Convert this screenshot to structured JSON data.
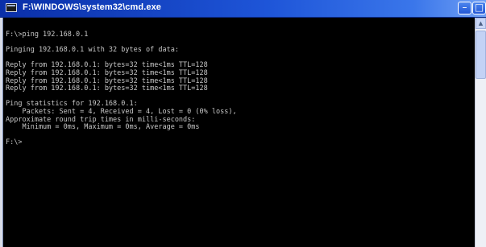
{
  "window": {
    "title": "F:\\WINDOWS\\system32\\cmd.exe",
    "icon": "console-icon",
    "controls": {
      "minimize": "–",
      "maximize": "□"
    }
  },
  "console": {
    "lines": [
      "F:\\>ping 192.168.0.1",
      "",
      "Pinging 192.168.0.1 with 32 bytes of data:",
      "",
      "Reply from 192.168.0.1: bytes=32 time<1ms TTL=128",
      "Reply from 192.168.0.1: bytes=32 time<1ms TTL=128",
      "Reply from 192.168.0.1: bytes=32 time<1ms TTL=128",
      "Reply from 192.168.0.1: bytes=32 time<1ms TTL=128",
      "",
      "Ping statistics for 192.168.0.1:",
      "    Packets: Sent = 4, Received = 4, Lost = 0 (0% loss),",
      "Approximate round trip times in milli-seconds:",
      "    Minimum = 0ms, Maximum = 0ms, Average = 0ms",
      "",
      "F:\\>"
    ]
  },
  "scrollbar": {
    "up_arrow": "▲"
  },
  "colors": {
    "titlebar": "#1e55d8",
    "console_background": "#000000",
    "console_text": "#c8c8c8"
  }
}
